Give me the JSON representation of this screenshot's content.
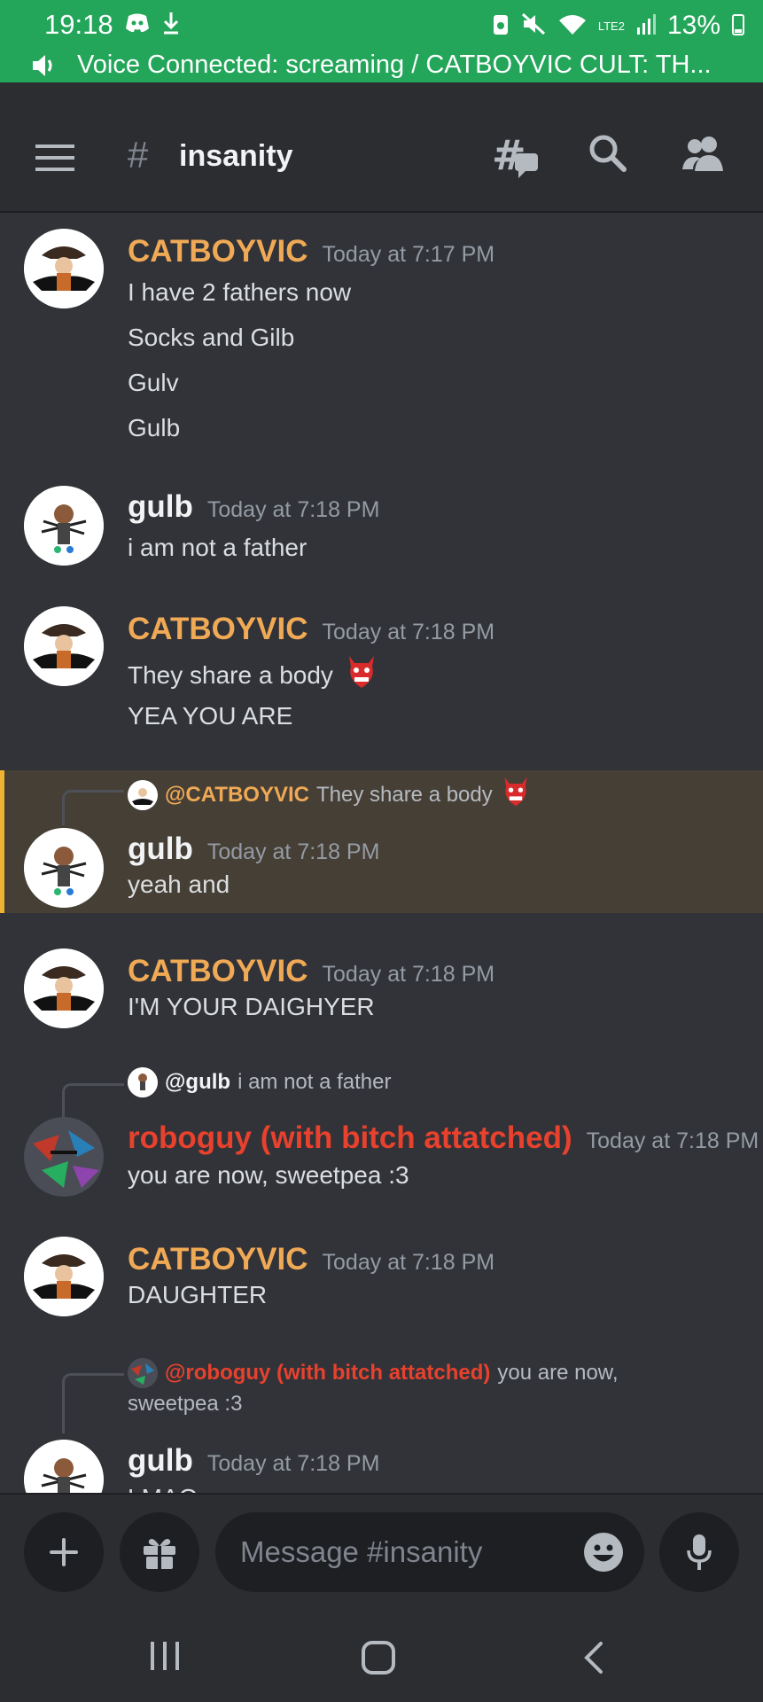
{
  "status_bar": {
    "time": "19:18",
    "battery": "13%",
    "network": "LTE2"
  },
  "voice_bar": {
    "text": "Voice Connected: screaming / CATBOYVIC CULT: TH..."
  },
  "header": {
    "hash": "#",
    "channel": "insanity"
  },
  "colors": {
    "accent_green": "#23a55a",
    "orange_user": "#f0a955",
    "red_user": "#e8412d",
    "highlight_bar": "#f0b232"
  },
  "messages": [
    {
      "author": "CATBOYVIC",
      "time": "Today at 7:17 PM",
      "lines": [
        "I have 2 fathers now",
        "Socks and Gilb",
        "Gulv",
        "Gulb"
      ]
    },
    {
      "author": "gulb",
      "time": "Today at 7:18 PM",
      "lines": [
        "i am not a father"
      ]
    },
    {
      "author": "CATBOYVIC",
      "time": "Today at 7:18 PM",
      "lines": [
        "They share a body",
        "YEA YOU ARE"
      ]
    },
    {
      "reply": {
        "mention": "@CATBOYVIC",
        "text": "They share a body"
      },
      "author": "gulb",
      "time": "Today at 7:18 PM",
      "lines": [
        "yeah and"
      ]
    },
    {
      "author": "CATBOYVIC",
      "time": "Today at 7:18 PM",
      "lines": [
        "I'M YOUR DAIGHYER"
      ]
    },
    {
      "reply": {
        "mention": "@gulb",
        "text": "i am not a father"
      },
      "author": "roboguy (with bitch attatched)",
      "time": "Today at 7:18 PM",
      "lines": [
        "you are now, sweetpea :3"
      ]
    },
    {
      "author": "CATBOYVIC",
      "time": "Today at 7:18 PM",
      "lines": [
        "DAUGHTER"
      ]
    },
    {
      "reply": {
        "mention": "@roboguy (with bitch attatched)",
        "text": "you are now,",
        "text2": "sweetpea :3"
      },
      "author": "gulb",
      "time": "Today at 7:18 PM",
      "lines": [
        "LMAO"
      ]
    }
  ],
  "composer": {
    "placeholder": "Message #insanity"
  }
}
